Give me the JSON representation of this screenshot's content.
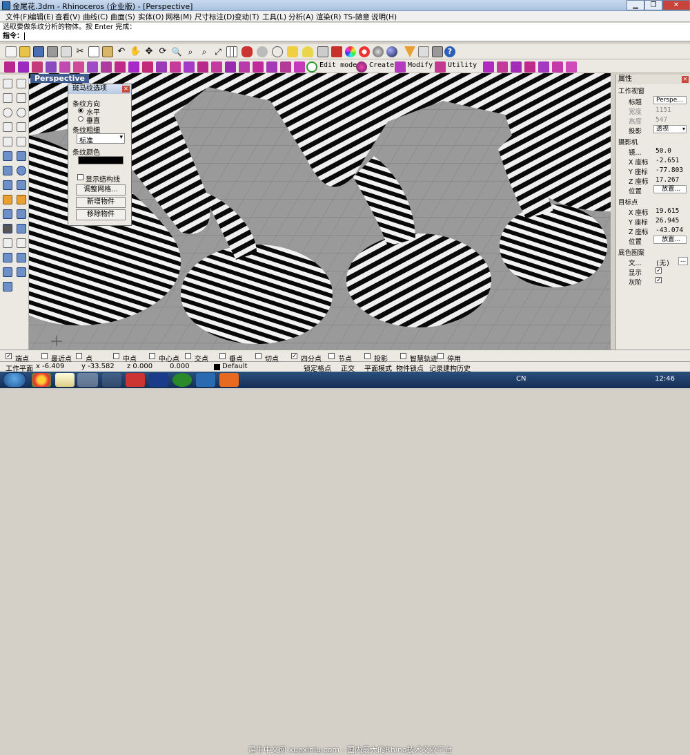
{
  "window": {
    "title": "金尾花.3dm - Rhinoceros (企业版) - [Perspective]",
    "controls": [
      "minimize-icon",
      "maximize-icon",
      "close-icon"
    ]
  },
  "menu": [
    {
      "label": "文件(F)"
    },
    {
      "label": "编辑(E)"
    },
    {
      "label": "查看(V)"
    },
    {
      "label": "曲线(C)"
    },
    {
      "label": "曲面(S)"
    },
    {
      "label": "实体(O)"
    },
    {
      "label": "网格(M)"
    },
    {
      "label": "尺寸标注(D)"
    },
    {
      "label": "变动(T)"
    },
    {
      "label": "工具(L)"
    },
    {
      "label": "分析(A)"
    },
    {
      "label": "渲染(R)"
    },
    {
      "label": "TS-随意"
    },
    {
      "label": "说明(H)"
    }
  ],
  "command": {
    "history": "选取要做条纹分析的物体。按 Enter 完成：",
    "prompt_label": "指令：",
    "prompt_value": ""
  },
  "toolbar2_labels": {
    "edit_mode": "Edit mode",
    "create": "Create",
    "modify": "Modify",
    "utility": "Utility"
  },
  "viewport": {
    "name": "Perspective"
  },
  "zebra_panel": {
    "title": "斑马纹选项",
    "direction_label": "条纹方向",
    "horizontal": "水平",
    "vertical": "垂直",
    "direction_selected": "水平",
    "thickness_label": "条纹粗细",
    "thickness_value": "标准",
    "color_label": "条纹颜色",
    "stripe_color": "#000000",
    "show_structure": "显示结构线",
    "show_structure_checked": false,
    "adjust_mesh": "调整网格...",
    "add_objects": "新增物件",
    "remove_objects": "移除物件"
  },
  "properties": {
    "title": "属性",
    "viewport_section": "工作视窗",
    "title_label": "标题",
    "title_value": "Perspe...",
    "width_label": "宽度",
    "width_value": "1151",
    "height_label": "高度",
    "height_value": "547",
    "projection_label": "投影",
    "projection_value": "透视",
    "camera_section": "摄影机",
    "lens_label": "镜...",
    "lens_value": "50.0",
    "cam_x_label": "X 座标",
    "cam_x": "-2.651",
    "cam_y_label": "Y 座标",
    "cam_y": "-77.803",
    "cam_z_label": "Z 座标",
    "cam_z": "17.267",
    "cam_pos_label": "位置",
    "place_button": "放置...",
    "target_section": "目标点",
    "tgt_x_label": "X 座标",
    "tgt_x": "19.615",
    "tgt_y_label": "Y 座标",
    "tgt_y": "26.945",
    "tgt_z_label": "Z 座标",
    "tgt_z": "-43.074",
    "tgt_pos_label": "位置",
    "tgt_place_button": "放置...",
    "wallpaper_section": "底色图案",
    "file_label": "文...",
    "file_value": "(无)",
    "file_button": "...",
    "show_label": "显示",
    "show_checked": true,
    "gray_label": "灰阶",
    "gray_checked": true
  },
  "osnap": [
    {
      "label": "端点",
      "checked": true
    },
    {
      "label": "最近点",
      "checked": false
    },
    {
      "label": "点",
      "checked": false
    },
    {
      "label": "中点",
      "checked": false
    },
    {
      "label": "中心点",
      "checked": false
    },
    {
      "label": "交点",
      "checked": false
    },
    {
      "label": "垂点",
      "checked": false
    },
    {
      "label": "切点",
      "checked": false
    },
    {
      "label": "四分点",
      "checked": true
    },
    {
      "label": "节点",
      "checked": false
    },
    {
      "label": "投影",
      "checked": false
    },
    {
      "label": "智慧轨迹",
      "checked": false
    },
    {
      "label": "停用",
      "checked": false
    }
  ],
  "status": {
    "cplane": "工作平面",
    "x": "x -6.409",
    "y": "y -33.582",
    "z": "z 0.000",
    "dist": "0.000",
    "layer": "Default",
    "lock_grid": "锁定格点",
    "ortho": "正交",
    "planar": "平面模式",
    "osnap": "物件锁点",
    "history": "记录建构历史"
  },
  "taskbar": {
    "clock": "12:46",
    "ime": "CN",
    "watermark": "犀牛中文网 xuexiniu.com - 国内最大的Rhino技术交流平台"
  }
}
